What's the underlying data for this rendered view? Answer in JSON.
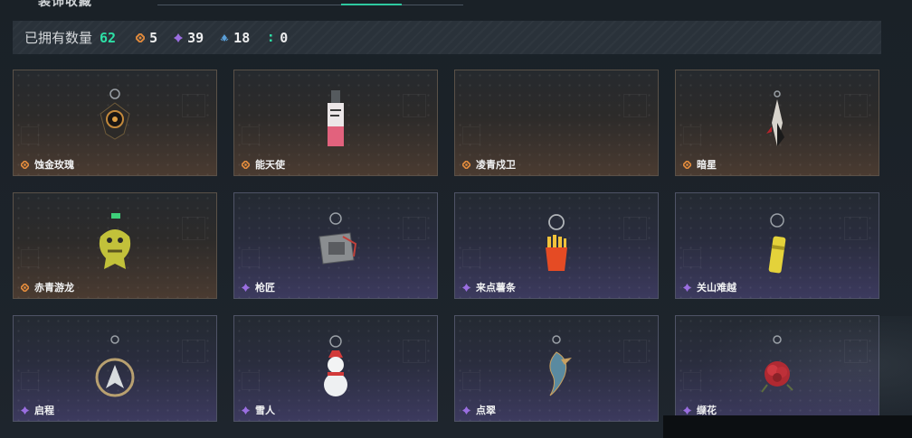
{
  "top": {
    "cut_title": "装饰收藏"
  },
  "summary": {
    "owned_label": "已拥有数量",
    "owned_total": "62",
    "stats": [
      {
        "icon": "orange-diamond-icon",
        "color": "#e08a3c",
        "value": "5"
      },
      {
        "icon": "purple-diamond-icon",
        "color": "#9a6ee0",
        "value": "39"
      },
      {
        "icon": "blue-diamond-icon",
        "color": "#5a9fd8",
        "value": "18"
      },
      {
        "icon": "green-diamond-icon",
        "color": "#2de0a6",
        "value": "0"
      }
    ]
  },
  "cards": [
    {
      "name": "蚀金玫瑰",
      "rarity": "orange"
    },
    {
      "name": "能天使",
      "rarity": "orange"
    },
    {
      "name": "凌青戍卫",
      "rarity": "orange"
    },
    {
      "name": "暗星",
      "rarity": "orange"
    },
    {
      "name": "赤青游龙",
      "rarity": "orange"
    },
    {
      "name": "枪匠",
      "rarity": "purple"
    },
    {
      "name": "来点薯条",
      "rarity": "purple"
    },
    {
      "name": "关山难越",
      "rarity": "purple"
    },
    {
      "name": "启程",
      "rarity": "purple"
    },
    {
      "name": "雪人",
      "rarity": "purple"
    },
    {
      "name": "点翠",
      "rarity": "purple"
    },
    {
      "name": "缬花",
      "rarity": "purple"
    }
  ]
}
